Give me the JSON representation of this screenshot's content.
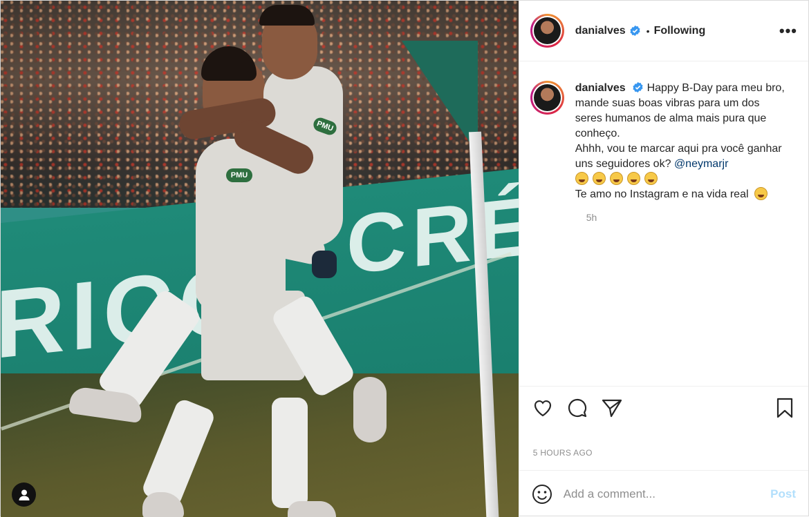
{
  "post": {
    "author": {
      "username": "danialves",
      "verified": true,
      "follow_status": "Following",
      "separator": "•"
    },
    "more_options": "•••",
    "caption": {
      "username": "danialves",
      "line1": "Happy B-Day para meu bro, mande suas boas vibras para um dos seres humanos de alma mais pura que conheço.",
      "line2": "Ahhh, vou te marcar aqui pra você ganhar uns seguidores ok?",
      "mention": "@neymarjr",
      "line3": "Te amo no Instagram e na vida real",
      "emoji_row_count": 5
    },
    "relative_time": "5h",
    "absolute_time": "5 HOURS AGO",
    "comment_box": {
      "placeholder": "Add a comment...",
      "post_label": "Post"
    },
    "icons": {
      "like": "heart-icon",
      "comment": "speech-bubble-icon",
      "share": "paper-plane-icon",
      "save": "bookmark-icon",
      "emoji": "smiley-icon",
      "user_tag": "person-icon"
    },
    "media": {
      "billboard_left": "RICOL",
      "billboard_right": "CRÉDI",
      "shirt_sponsor": "PMU"
    }
  }
}
